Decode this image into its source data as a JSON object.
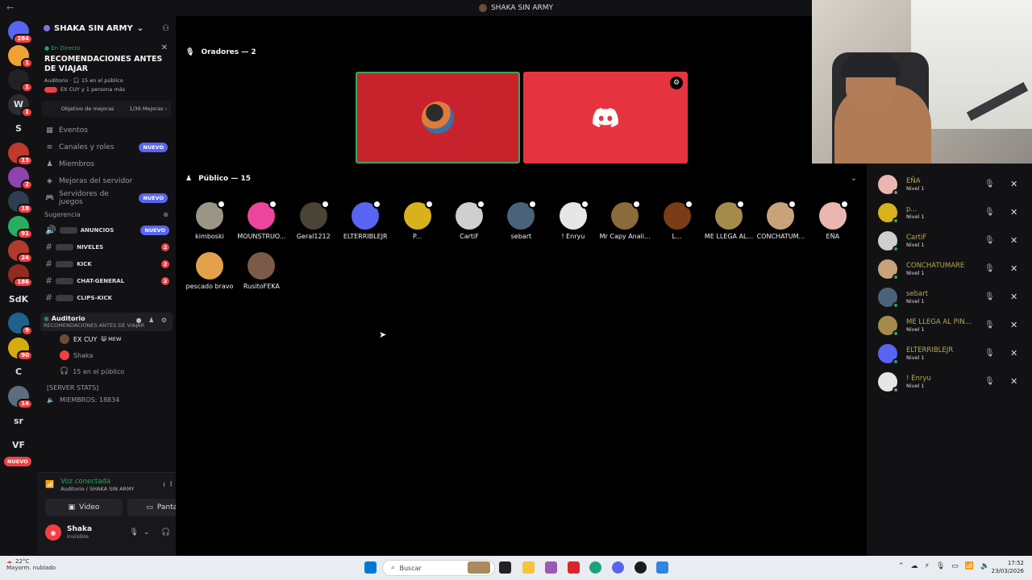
{
  "titlebar": {
    "title": "SHAKA SIN ARMY",
    "back": "←"
  },
  "server_rail": [
    {
      "label": "",
      "badge": "284",
      "color": "#5865f2"
    },
    {
      "label": "",
      "badge": "1",
      "color": "#f0a232"
    },
    {
      "label": "",
      "badge": "1",
      "color": "#202225"
    },
    {
      "label": "W",
      "badge": "1",
      "color": "#2b2d31"
    },
    {
      "label": "S",
      "badge": "",
      "color": "#121214"
    },
    {
      "label": "",
      "badge": "13",
      "color": "#c0392b"
    },
    {
      "label": "",
      "badge": "2",
      "color": "#8e44ad"
    },
    {
      "label": "",
      "badge": "18",
      "color": "#2c3e50"
    },
    {
      "label": "",
      "badge": "91",
      "color": "#27ae60"
    },
    {
      "label": "",
      "badge": "24",
      "color": "#b03a2e"
    },
    {
      "label": "",
      "badge": "186",
      "color": "#922b21"
    },
    {
      "label": "SdK",
      "badge": "",
      "color": "#121214"
    },
    {
      "label": "",
      "badge": "9",
      "color": "#1f618d"
    },
    {
      "label": "",
      "badge": "90",
      "color": "#d4ac0d"
    },
    {
      "label": "C",
      "badge": "",
      "color": "#121214"
    },
    {
      "label": "",
      "badge": "14",
      "color": "#5d6d7e"
    },
    {
      "label": "sr",
      "badge": "",
      "color": "#121214"
    },
    {
      "label": "VF",
      "badge": "",
      "color": "#121214"
    }
  ],
  "rail_new": "NUEVO",
  "guild": {
    "name": "SHAKA SIN ARMY"
  },
  "event": {
    "live": "En Directo",
    "title": "RECOMENDACIONES ANTES DE VIAJAR",
    "stage_info": "Auditorio · 🎧 15 en el público",
    "hosts": "EX CUY y 1 persona más"
  },
  "goal": {
    "label": "Objetivo de mejoras",
    "value": "1/36 Mejoras ›"
  },
  "nav": [
    {
      "label": "Eventos",
      "icon": "calendar-icon",
      "glyph": "▦",
      "badge": ""
    },
    {
      "label": "Canales y roles",
      "icon": "channels-icon",
      "glyph": "≡",
      "badge": "NUEVO"
    },
    {
      "label": "Miembros",
      "icon": "members-icon",
      "glyph": "♟",
      "badge": ""
    },
    {
      "label": "Mejoras del servidor",
      "icon": "boost-icon",
      "glyph": "◈",
      "badge": ""
    },
    {
      "label": "Servidores de juegos",
      "icon": "gamepad-icon",
      "glyph": "🎮",
      "badge": "NUEVO"
    }
  ],
  "suggest": {
    "label": "Sugerencia",
    "close": "⊗"
  },
  "channels": [
    {
      "label": "ANUNCIOS",
      "badge": "NUEVO",
      "count": ""
    },
    {
      "label": "NIVELES",
      "badge": "",
      "count": "2"
    },
    {
      "label": "KICK",
      "badge": "",
      "count": "2"
    },
    {
      "label": "CHAT-GENERAL",
      "badge": "",
      "count": "2"
    },
    {
      "label": "CLIPS-KICK",
      "badge": "",
      "count": ""
    }
  ],
  "voice_channel": {
    "name": "Auditorio",
    "sub": "RECOMENDACIONES ANTES DE VIAJAR",
    "users": [
      {
        "name": "EX CUY",
        "tag": "😺 MEW",
        "color": "#6b4c3b"
      },
      {
        "name": "Shaka",
        "tag": "",
        "color": "#f23f43"
      }
    ],
    "audience": "15 en el público"
  },
  "server_stats": {
    "header": "[SERVER STATS]",
    "members": "MIEMBROS: 18834"
  },
  "voice_panel": {
    "status": "Voz conectada",
    "where": "Auditorio / SHAKA SIN ARMY",
    "video": "Video",
    "screen": "Pantalla"
  },
  "user": {
    "name": "Shaka",
    "status": "Invisible"
  },
  "stage": {
    "speakers_header": "Oradores — 2",
    "audience_header": "Público — 15",
    "audience": [
      {
        "name": "kimboski",
        "color": "#9b9586"
      },
      {
        "name": "MOUNSTRUO...",
        "color": "#eb459e"
      },
      {
        "name": "Geral1212",
        "color": "#4a4436"
      },
      {
        "name": "ELTERRIBLEJR",
        "color": "#5865f2"
      },
      {
        "name": "P...",
        "color": "#d8b21c"
      },
      {
        "name": "CartiF",
        "color": "#cfcfcf"
      },
      {
        "name": "sebart",
        "color": "#4a6378"
      },
      {
        "name": "! Enryu",
        "color": "#e6e6e6"
      },
      {
        "name": "Mr Capy Anali...",
        "color": "#8b6a3c"
      },
      {
        "name": "L...",
        "color": "#7a3c16"
      },
      {
        "name": "ME LLEGA AL...",
        "color": "#a58a4a"
      },
      {
        "name": "CONCHATUM...",
        "color": "#c9a27a"
      },
      {
        "name": "EÑA",
        "color": "#e9b7b0"
      },
      {
        "name": "pescado bravo",
        "color": "#e3a24a"
      },
      {
        "name": "RusitoFEKA",
        "color": "#7b5a48"
      }
    ]
  },
  "right_list": [
    {
      "name": "EÑA",
      "level": "Nivel 1",
      "color": "#e9b7b0",
      "name_color": "#b5a94f",
      "status": "#80848e"
    },
    {
      "name": "p...",
      "level": "Nivel 1",
      "color": "#d8b21c",
      "name_color": "#b5a94f",
      "status": "#23a55a"
    },
    {
      "name": "CartiF",
      "level": "Nivel 1",
      "color": "#cfcfcf",
      "name_color": "#b5a94f",
      "status": "#23a55a"
    },
    {
      "name": "CONCHATUMARE",
      "level": "Nivel 1",
      "color": "#c9a27a",
      "name_color": "#b5a94f",
      "status": "#23a55a"
    },
    {
      "name": "sebart",
      "level": "Nivel 1",
      "color": "#4a6378",
      "name_color": "#b5a94f",
      "status": "#23a55a"
    },
    {
      "name": "ME LLEGA AL PIN...",
      "level": "Nivel 1",
      "color": "#a58a4a",
      "name_color": "#b5a94f",
      "status": "#23a55a"
    },
    {
      "name": "ELTERRIBLEJR",
      "level": "Nivel 1",
      "color": "#5865f2",
      "name_color": "#b5a94f",
      "status": "#23a55a"
    },
    {
      "name": "! Enryu",
      "level": "Nivel 1",
      "color": "#e6e6e6",
      "name_color": "#b5a94f",
      "status": "#80848e"
    }
  ],
  "taskbar": {
    "temp": "22°C",
    "weather": "Mayorm. nublado",
    "search": "Buscar",
    "time": "17:52",
    "date": "23/03/2026"
  }
}
